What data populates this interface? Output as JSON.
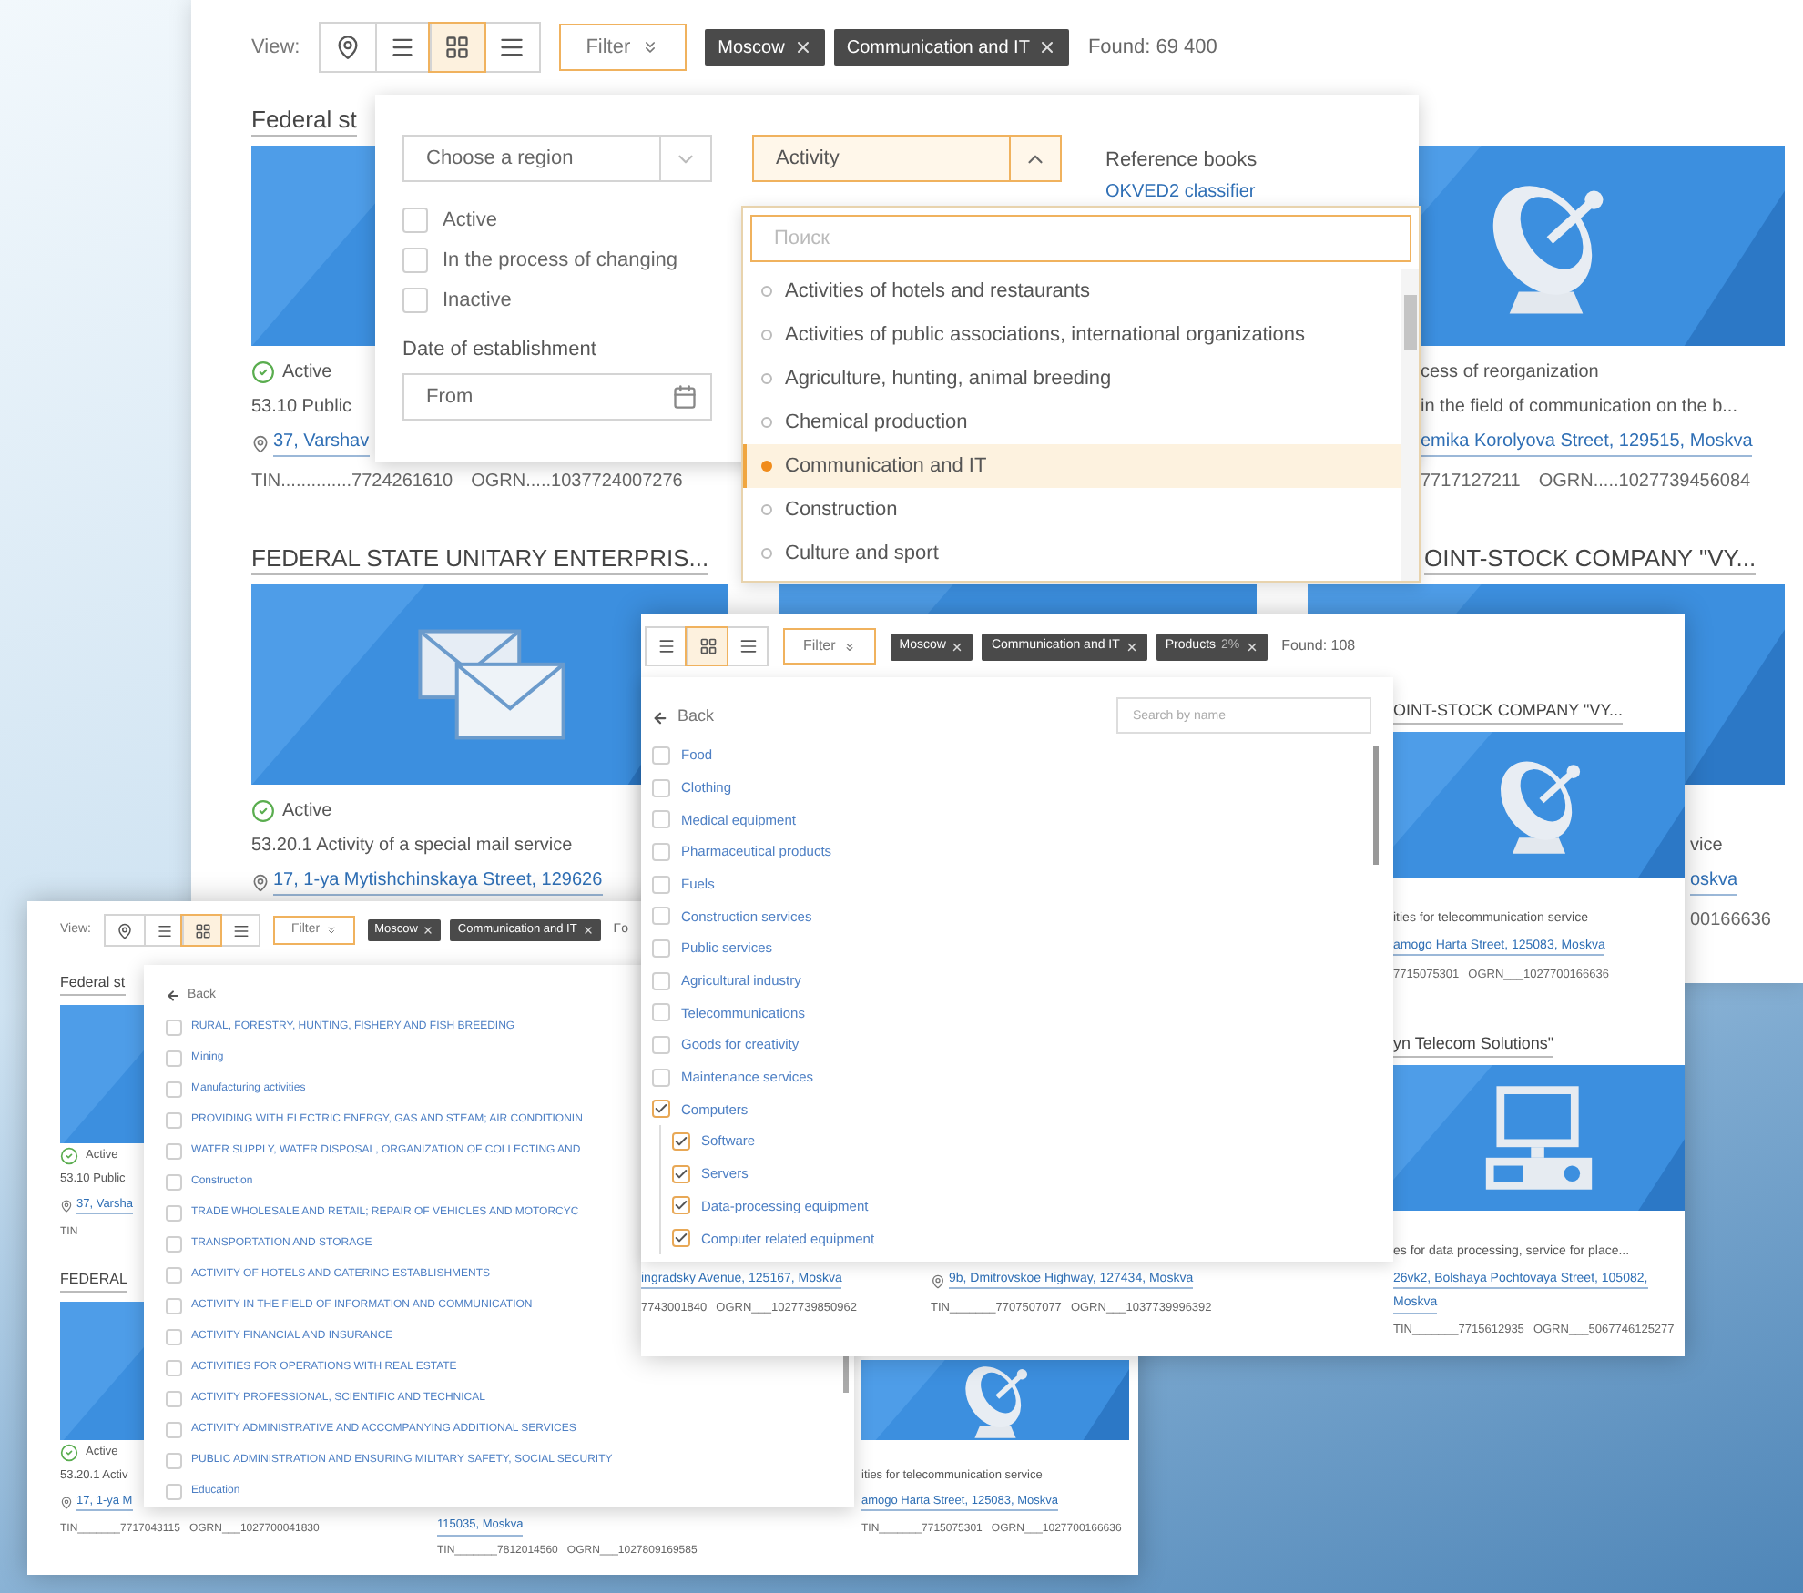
{
  "activity_window": {
    "toolbar": {
      "view_label": "View:",
      "view_modes": [
        {
          "kind": "map",
          "selected": false
        },
        {
          "kind": "list",
          "selected": false
        },
        {
          "kind": "grid",
          "selected": true
        },
        {
          "kind": "compact",
          "selected": false
        }
      ],
      "filter": "Filter",
      "chips": [
        {
          "label": "Moscow"
        },
        {
          "label": "Communication and IT"
        }
      ],
      "found": "Found: 69 400"
    },
    "columns": [
      {
        "cards": [
          {
            "title": "Federal st",
            "image": {
              "kind": "picture"
            },
            "status": "Active",
            "status_icon": true,
            "activity": "53.10 Public",
            "pin": true,
            "address": "37, Varshav",
            "tin": "TIN..............7724261610",
            "ogrn": "OGRN.....1037724007276"
          },
          {
            "title": "FEDERAL STATE UNITARY ENTERPRIS...",
            "image": {
              "kind": "picture"
            },
            "status": "Active",
            "status_icon": true,
            "activity": "53.20.1 Activity of a special mail service",
            "pin": true,
            "address": "17, 1-ya Mytishchinskaya Street, 129626"
          }
        ]
      },
      {
        "cards": [
          {
            "image": {
              "kind": "picture"
            }
          }
        ]
      },
      {
        "cards": [
          {
            "image": {
              "kind": "picture"
            },
            "status": "cess of reorganization",
            "status_icon": false,
            "activity": "in the field of communication on the b...",
            "pin": false,
            "address": "emika Korolyova Street, 129515, Moskva",
            "tin": "7717127211",
            "ogrn": "OGRN.....1027739456084"
          },
          {
            "title": "OINT-STOCK COMPANY \"VY...",
            "image": {
              "kind": "picture"
            },
            "activity": "vice",
            "address": "oskva",
            "ogrn": "00166636"
          }
        ]
      }
    ],
    "filter_panel": {
      "region": {
        "placeholder": "Choose a region",
        "expanded": false
      },
      "statuses": [
        {
          "label": "Active",
          "checked": false
        },
        {
          "label": "In the process of changing",
          "checked": false
        },
        {
          "label": "Inactive",
          "checked": false
        }
      ],
      "date_label": "Date of establishment",
      "date_from": {
        "placeholder": "From"
      },
      "activity": {
        "value": "Activity",
        "expanded": true
      },
      "reference_title": "Reference books",
      "reference_link": "OKVED2 classifier",
      "activity_list": {
        "search": {
          "placeholder": "Поиск"
        },
        "items": [
          {
            "label": "Activities of hotels and restaurants",
            "selected": false
          },
          {
            "label": "Activities of public associations, international organizations",
            "selected": false
          },
          {
            "label": "Agriculture, hunting, animal breeding",
            "selected": false
          },
          {
            "label": "Chemical production",
            "selected": false
          },
          {
            "label": "Communication and IT",
            "selected": true
          },
          {
            "label": "Construction",
            "selected": false
          },
          {
            "label": "Culture and sport",
            "selected": false
          }
        ]
      }
    }
  },
  "sections_window": {
    "toolbar": {
      "view_label": "View:",
      "view_modes": [
        {
          "kind": "map",
          "selected": false
        },
        {
          "kind": "list",
          "selected": false
        },
        {
          "kind": "grid",
          "selected": true
        },
        {
          "kind": "compact",
          "selected": false
        }
      ],
      "filter": "Filter",
      "chips": [
        {
          "label": "Moscow"
        },
        {
          "label": "Communication and IT"
        }
      ],
      "found": "Fo"
    },
    "columns": [
      {
        "cards": [
          {
            "title": "Federal st",
            "image": {
              "kind": "picture"
            },
            "status": "Active",
            "status_icon": true,
            "activity": "53.10 Public",
            "pin": true,
            "address": "37, Varsha",
            "tin": "TIN"
          },
          {
            "title": "FEDERAL",
            "image": {
              "kind": "picture"
            },
            "status": "Active",
            "status_icon": true,
            "activity": "53.20.1 Activ",
            "pin": true,
            "address": "17, 1-ya M",
            "tin": "TIN_______7717043115",
            "ogrn": "OGRN___1027700041830"
          }
        ]
      },
      {
        "cards": [
          {
            "address_2": "115035, Moskva",
            "tin": "TIN_______7812014560",
            "ogrn": "OGRN___1027809169585"
          }
        ]
      },
      {
        "cards": [
          {
            "image": {
              "kind": "picture"
            },
            "activity": "ities for telecommunication service",
            "address": "amogo Harta Street, 125083, Moskva",
            "tin": "TIN_______7715075301",
            "ogrn": "OGRN___1027700166636"
          }
        ]
      }
    ],
    "sections_panel": {
      "back": "Back",
      "items": [
        {
          "label": "RURAL, FORESTRY, HUNTING, FISHERY AND FISH BREEDING",
          "checked": false
        },
        {
          "label": "Mining",
          "checked": false
        },
        {
          "label": "Manufacturing activities",
          "checked": false
        },
        {
          "label": "PROVIDING WITH ELECTRIC ENERGY, GAS AND STEAM; AIR CONDITIONIN",
          "checked": false
        },
        {
          "label": "WATER SUPPLY, WATER DISPOSAL, ORGANIZATION OF COLLECTING AND",
          "checked": false
        },
        {
          "label": "Construction",
          "checked": false
        },
        {
          "label": "TRADE WHOLESALE AND RETAIL; REPAIR OF VEHICLES AND MOTORCYC",
          "checked": false
        },
        {
          "label": "TRANSPORTATION AND STORAGE",
          "checked": false
        },
        {
          "label": "ACTIVITY OF HOTELS AND CATERING ESTABLISHMENTS",
          "checked": false
        },
        {
          "label": "ACTIVITY IN THE FIELD OF INFORMATION AND COMMUNICATION",
          "checked": false
        },
        {
          "label": "ACTIVITY FINANCIAL AND INSURANCE",
          "checked": false
        },
        {
          "label": "ACTIVITIES FOR OPERATIONS WITH REAL ESTATE",
          "checked": false
        },
        {
          "label": "ACTIVITY PROFESSIONAL, SCIENTIFIC AND TECHNICAL",
          "checked": false
        },
        {
          "label": "ACTIVITY ADMINISTRATIVE AND ACCOMPANYING ADDITIONAL SERVICES",
          "checked": false
        },
        {
          "label": "PUBLIC ADMINISTRATION AND ENSURING MILITARY SAFETY, SOCIAL SECURITY",
          "checked": false
        },
        {
          "label": "Education",
          "checked": false
        }
      ]
    }
  },
  "products_window": {
    "toolbar": {
      "view_modes": [
        {
          "kind": "list",
          "selected": false
        },
        {
          "kind": "grid",
          "selected": true
        },
        {
          "kind": "compact",
          "selected": false
        }
      ],
      "filter": "Filter",
      "chips": [
        {
          "label": "Moscow"
        },
        {
          "label": "Communication and IT"
        },
        {
          "label": "Products",
          "detail": "2%"
        }
      ],
      "found": "Found: 108"
    },
    "columns": [
      {
        "cards": [
          {
            "address": "ingradsky Avenue, 125167, Moskva",
            "tin": "7743001840",
            "ogrn": "OGRN___1027739850962"
          }
        ]
      },
      {
        "cards": [
          {
            "pin": true,
            "address": "9b, Dmitrovskoe Highway, 127434, Moskva",
            "tin": "TIN_______7707507077",
            "ogrn": "OGRN___1037739996392"
          }
        ]
      },
      {
        "cards": [
          {
            "title": "OINT-STOCK COMPANY \"VY...",
            "image": {
              "kind": "picture"
            },
            "activity": "ities for telecommunication service",
            "address": "amogo Harta Street, 125083, Moskva",
            "tin": "7715075301",
            "ogrn": "OGRN___1027700166636"
          },
          {
            "title": "yn Telecom Solutions\"",
            "image": {
              "kind": "picture"
            },
            "activity": "es for data processing, service for place...",
            "address": "26vk2, Bolshaya Pochtovaya Street, 105082,",
            "address_2": "Moskva",
            "tin": "TIN_______7715612935",
            "ogrn": "OGRN___5067746125277"
          }
        ]
      }
    ],
    "products_panel": {
      "back": "Back",
      "search": {
        "placeholder": "Search by name"
      },
      "items": [
        {
          "label": "Food",
          "checked": false
        },
        {
          "label": "Clothing",
          "checked": false
        },
        {
          "label": "Medical equipment",
          "checked": false
        },
        {
          "label": "Pharmaceutical products",
          "checked": false
        },
        {
          "label": "Fuels",
          "checked": false
        },
        {
          "label": "Construction services",
          "checked": false
        },
        {
          "label": "Public services",
          "checked": false
        },
        {
          "label": "Agricultural industry",
          "checked": false
        },
        {
          "label": "Telecommunications",
          "checked": false
        },
        {
          "label": "Goods for creativity",
          "checked": false
        },
        {
          "label": "Maintenance services",
          "checked": false
        },
        {
          "label": "Computers",
          "checked": true,
          "children": [
            {
              "label": "Software",
              "checked": true
            },
            {
              "label": "Servers",
              "checked": true
            },
            {
              "label": "Data-processing equipment",
              "checked": true
            },
            {
              "label": "Computer related equipment",
              "checked": true
            }
          ]
        }
      ]
    }
  }
}
